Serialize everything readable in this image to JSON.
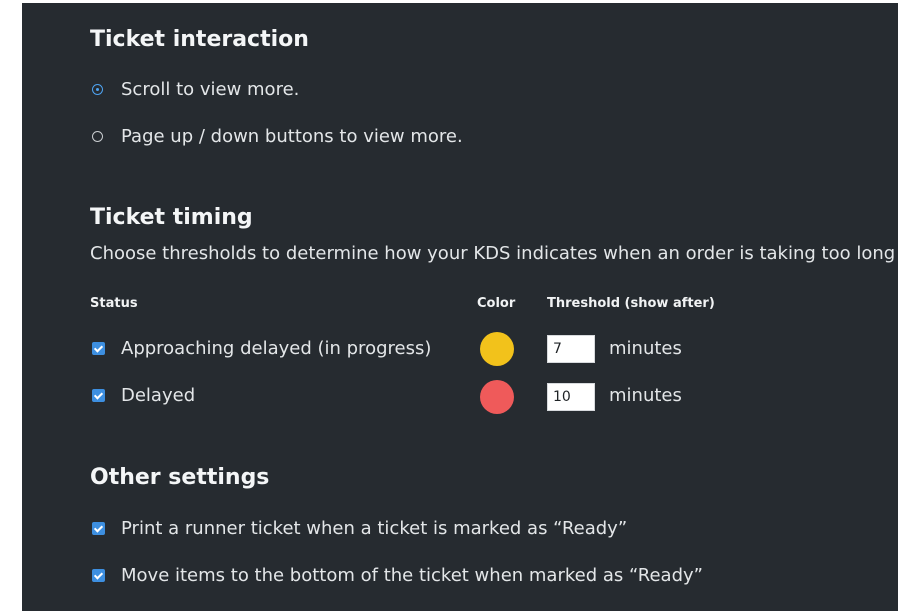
{
  "colors": {
    "panel_bg": "#262b30",
    "accent": "#3d8fe0",
    "approaching_color": "#f2c21b",
    "delayed_color": "#ef5a5a"
  },
  "ticket_interaction": {
    "title": "Ticket interaction",
    "options": [
      {
        "label": "Scroll to view more.",
        "selected": true
      },
      {
        "label": "Page up / down buttons to view more.",
        "selected": false
      }
    ]
  },
  "ticket_timing": {
    "title": "Ticket timing",
    "description": "Choose thresholds to determine how your KDS indicates when an order is taking too long",
    "headers": {
      "status": "Status",
      "color": "Color",
      "threshold": "Threshold (show after)"
    },
    "rows": [
      {
        "label": "Approaching delayed (in progress)",
        "checked": true,
        "color": "#f2c21b",
        "threshold": "7",
        "unit": "minutes"
      },
      {
        "label": "Delayed",
        "checked": true,
        "color": "#ef5a5a",
        "threshold": "10",
        "unit": "minutes"
      }
    ]
  },
  "other_settings": {
    "title": "Other settings",
    "options": [
      {
        "label": "Print a runner ticket when a ticket is marked as “Ready”",
        "checked": true
      },
      {
        "label": "Move items to the bottom of the ticket when marked as “Ready”",
        "checked": true
      }
    ]
  }
}
